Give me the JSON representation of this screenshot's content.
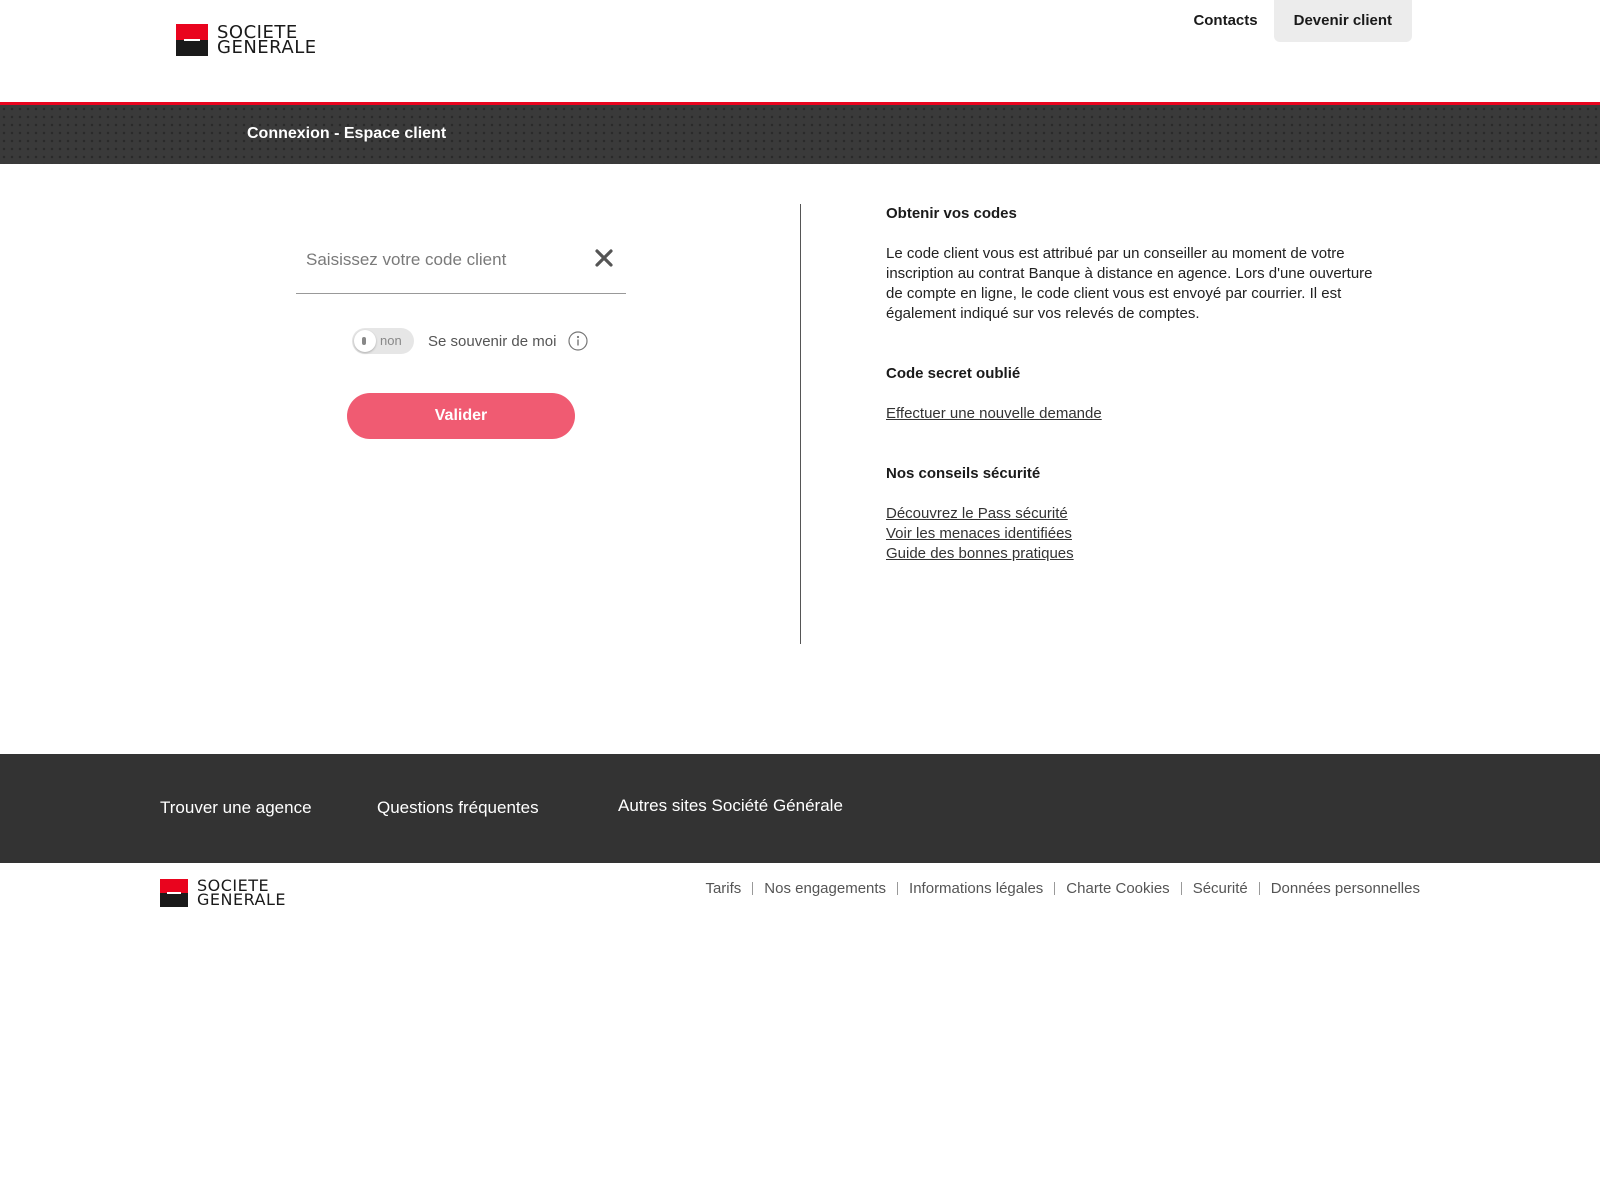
{
  "brand": {
    "line1": "SOCIETE",
    "line2": "GENERALE"
  },
  "top_nav": {
    "contacts": "Contacts",
    "become_client": "Devenir client"
  },
  "banner": {
    "title": "Connexion - Espace client"
  },
  "login": {
    "client_code_placeholder": "Saisissez votre code client",
    "client_code_value": "",
    "remember_toggle_state": "non",
    "remember_label": "Se souvenir de moi",
    "submit_label": "Valider"
  },
  "help": {
    "obtain_title": "Obtenir vos codes",
    "obtain_text": "Le code client vous est attribué par un conseiller au moment de votre inscription au contrat Banque à distance en agence. Lors d'une ouverture de compte en ligne, le code client vous est envoyé par courrier. Il est également indiqué sur vos relevés de comptes.",
    "forgot_title": "Code secret oublié",
    "forgot_link": "Effectuer une nouvelle demande",
    "security_title": "Nos conseils sécurité",
    "security_links": [
      "Découvrez le Pass sécurité",
      "Voir les menaces identifiées",
      "Guide des bonnes pratiques"
    ]
  },
  "footer": {
    "links": [
      "Trouver une agence",
      "Questions fréquentes",
      "Autres sites Société Générale"
    ],
    "legal": [
      "Tarifs",
      "Nos engagements",
      "Informations légales",
      "Charte Cookies",
      "Sécurité",
      "Données personnelles"
    ]
  },
  "colors": {
    "brand_red": "#e9041e",
    "button": "#f05b72",
    "dark": "#333333"
  },
  "icons": {
    "clear": "close-icon",
    "info": "info-icon",
    "toggle": "toggle-switch"
  }
}
